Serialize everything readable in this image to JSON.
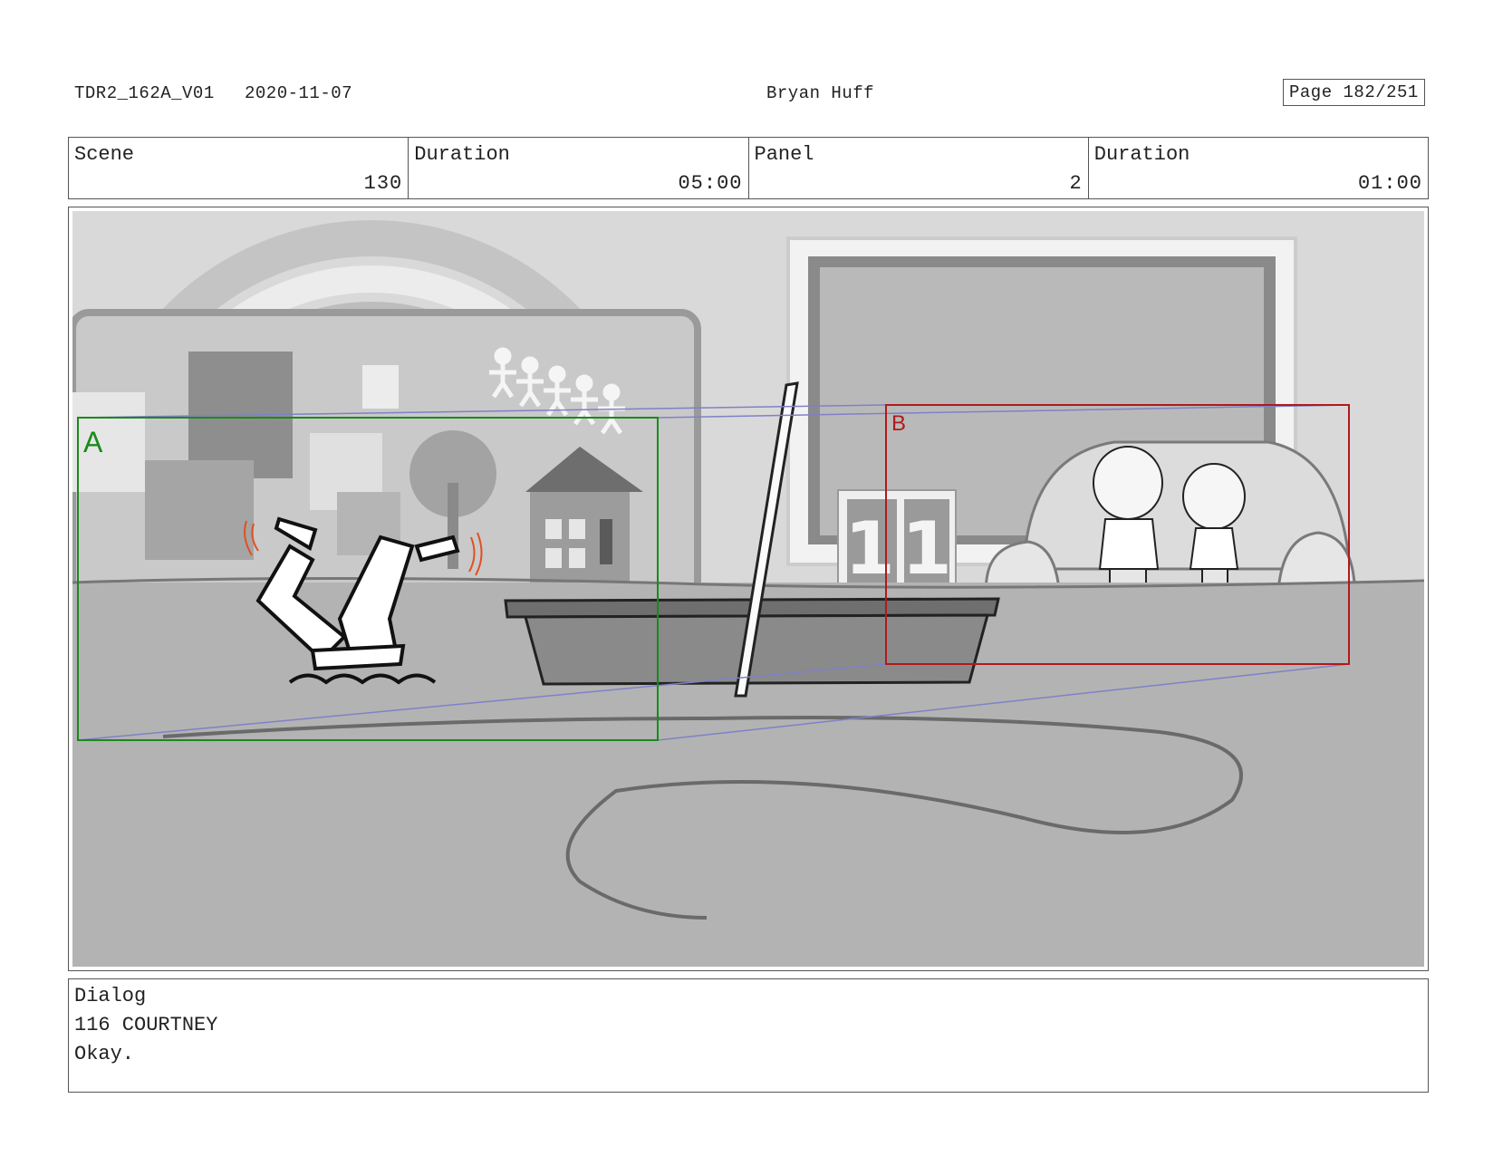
{
  "header": {
    "file_id": "TDR2_162A_V01",
    "date": "2020-11-07",
    "artist": "Bryan Huff",
    "page": "Page 182/251"
  },
  "info": {
    "scene_label": "Scene",
    "scene_value": "130",
    "scene_duration_label": "Duration",
    "scene_duration_value": "05:00",
    "panel_label": "Panel",
    "panel_value": "2",
    "panel_duration_label": "Duration",
    "panel_duration_value": "01:00"
  },
  "camera": {
    "frame_a_label": "A",
    "frame_a_color": "#1a8a1a",
    "frame_b_label": "B",
    "frame_b_color": "#b01a1a",
    "move_arrow_color": "#8080c8"
  },
  "dialog": {
    "label": "Dialog",
    "character": "116 COURTNEY",
    "line": "Okay."
  }
}
